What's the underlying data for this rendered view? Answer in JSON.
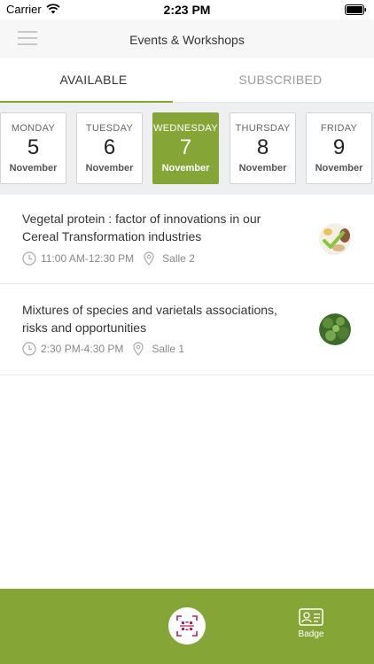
{
  "status_bar": {
    "carrier": "Carrier",
    "time": "2:23 PM"
  },
  "header": {
    "title": "Events & Workshops"
  },
  "tabs": [
    {
      "label": "AVAILABLE",
      "active": true
    },
    {
      "label": "SUBSCRIBED",
      "active": false
    }
  ],
  "days": [
    {
      "weekday": "MONDAY",
      "date": "5",
      "month": "November",
      "selected": false
    },
    {
      "weekday": "TUESDAY",
      "date": "6",
      "month": "November",
      "selected": false
    },
    {
      "weekday": "WEDNESDAY",
      "date": "7",
      "month": "November",
      "selected": true
    },
    {
      "weekday": "THURSDAY",
      "date": "8",
      "month": "November",
      "selected": false
    },
    {
      "weekday": "FRIDAY",
      "date": "9",
      "month": "November",
      "selected": false
    }
  ],
  "events": [
    {
      "title": "Vegetal protein : factor of innovations in our Cereal Transformation industries",
      "time": "11:00 AM-12:30 PM",
      "location": "Salle 2",
      "thumbnail_icon": "food-protein-thumbnail"
    },
    {
      "title": "Mixtures of species and varietals associations, risks and opportunities",
      "time": "2:30 PM-4:30 PM",
      "location": "Salle 1",
      "thumbnail_icon": "plants-thumbnail"
    }
  ],
  "bottom_bar": {
    "badge_label": "Badge"
  },
  "colors": {
    "accent": "#85a637",
    "strip_bg": "#eeeff1",
    "inactive_text": "#9a9a9a"
  }
}
